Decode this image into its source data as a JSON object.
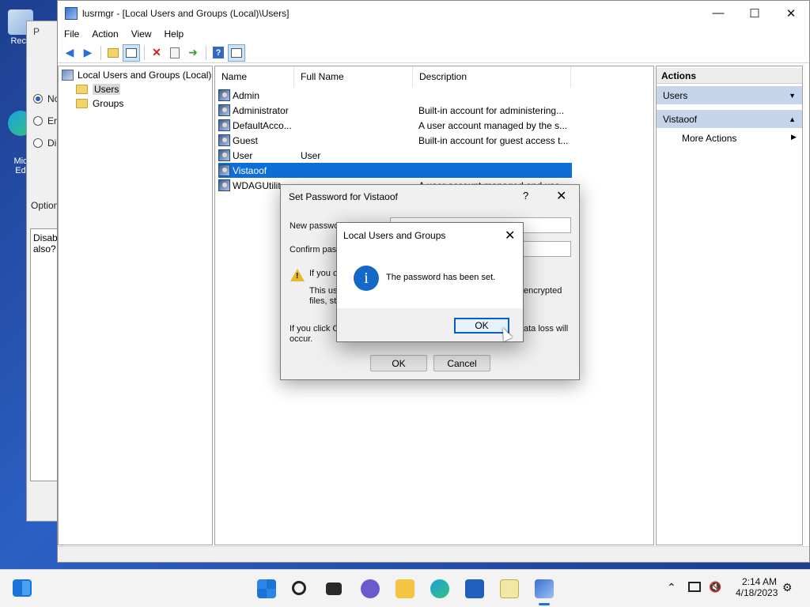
{
  "desktop": {
    "icons": [
      {
        "label": "Recy"
      },
      {
        "label": "Mic\nEd"
      }
    ]
  },
  "bg_window": {
    "title": "P",
    "radios": [
      "No",
      "En",
      "Di"
    ],
    "options_label": "Option",
    "box_text": "Disab\nalso?"
  },
  "window": {
    "title": "lusrmgr - [Local Users and Groups (Local)\\Users]",
    "controls": {
      "minimize": "—",
      "maximize": "☐",
      "close": "✕"
    }
  },
  "menu": [
    "File",
    "Action",
    "View",
    "Help"
  ],
  "toolbar": {
    "icons": [
      "back-icon",
      "forward-icon",
      "up-folder-icon",
      "show-tree-icon",
      "delete-icon",
      "properties-icon",
      "export-icon",
      "help-icon",
      "show-action-pane-icon"
    ]
  },
  "tree": {
    "root": "Local Users and Groups (Local)",
    "children": [
      "Users",
      "Groups"
    ]
  },
  "list": {
    "columns": [
      "Name",
      "Full Name",
      "Description"
    ],
    "rows": [
      {
        "name": "Admin",
        "full_name": "",
        "description": ""
      },
      {
        "name": "Administrator",
        "full_name": "",
        "description": "Built-in account for administering..."
      },
      {
        "name": "DefaultAcco...",
        "full_name": "",
        "description": "A user account managed by the s..."
      },
      {
        "name": "Guest",
        "full_name": "",
        "description": "Built-in account for guest access t..."
      },
      {
        "name": "User",
        "full_name": "User",
        "description": ""
      },
      {
        "name": "Vistaoof",
        "full_name": "",
        "description": ""
      },
      {
        "name": "WDAGUtilit...",
        "full_name": "",
        "description": "A user account managed and use..."
      }
    ]
  },
  "actions": {
    "header": "Actions",
    "sections": [
      {
        "label": "Users",
        "arrow": "▼"
      },
      {
        "label": "Vistaoof",
        "arrow": "▲"
      }
    ],
    "items": [
      "More Actions"
    ],
    "item_arrow": "▶"
  },
  "set_password_dialog": {
    "title": "Set Password for Vistaoof",
    "help": "?",
    "close": "✕",
    "new_password_label": "New passwo",
    "confirm_password_label": "Confirm pass",
    "warning_line1": "If you c",
    "warning_line2": "This us",
    "warning_line2_right": "encrypted",
    "warning_line3": "files, sto",
    "info_line1": "If you click C",
    "info_line1_right": "ata loss will",
    "info_line2": "occur.",
    "ok": "OK",
    "cancel": "Cancel"
  },
  "message_box": {
    "title": "Local Users and Groups",
    "close": "✕",
    "icon": "i",
    "message": "The password has been set.",
    "ok": "OK"
  },
  "taskbar": {
    "icons": [
      "start-icon",
      "search-icon",
      "task-view-icon",
      "chat-icon",
      "file-explorer-icon",
      "edge-icon",
      "store-icon",
      "notepad-icon",
      "lusrmgr-icon"
    ],
    "time": "2:14 AM",
    "date": "4/18/2023",
    "tray_icons": [
      "chevron-up-icon",
      "network-icon",
      "volume-icon",
      "notification-icon"
    ]
  },
  "colors": {
    "selection": "#0d6fd6",
    "actions_section": "#c6d5ea",
    "info_icon": "#1668c6",
    "warning_icon": "#e8b828"
  }
}
